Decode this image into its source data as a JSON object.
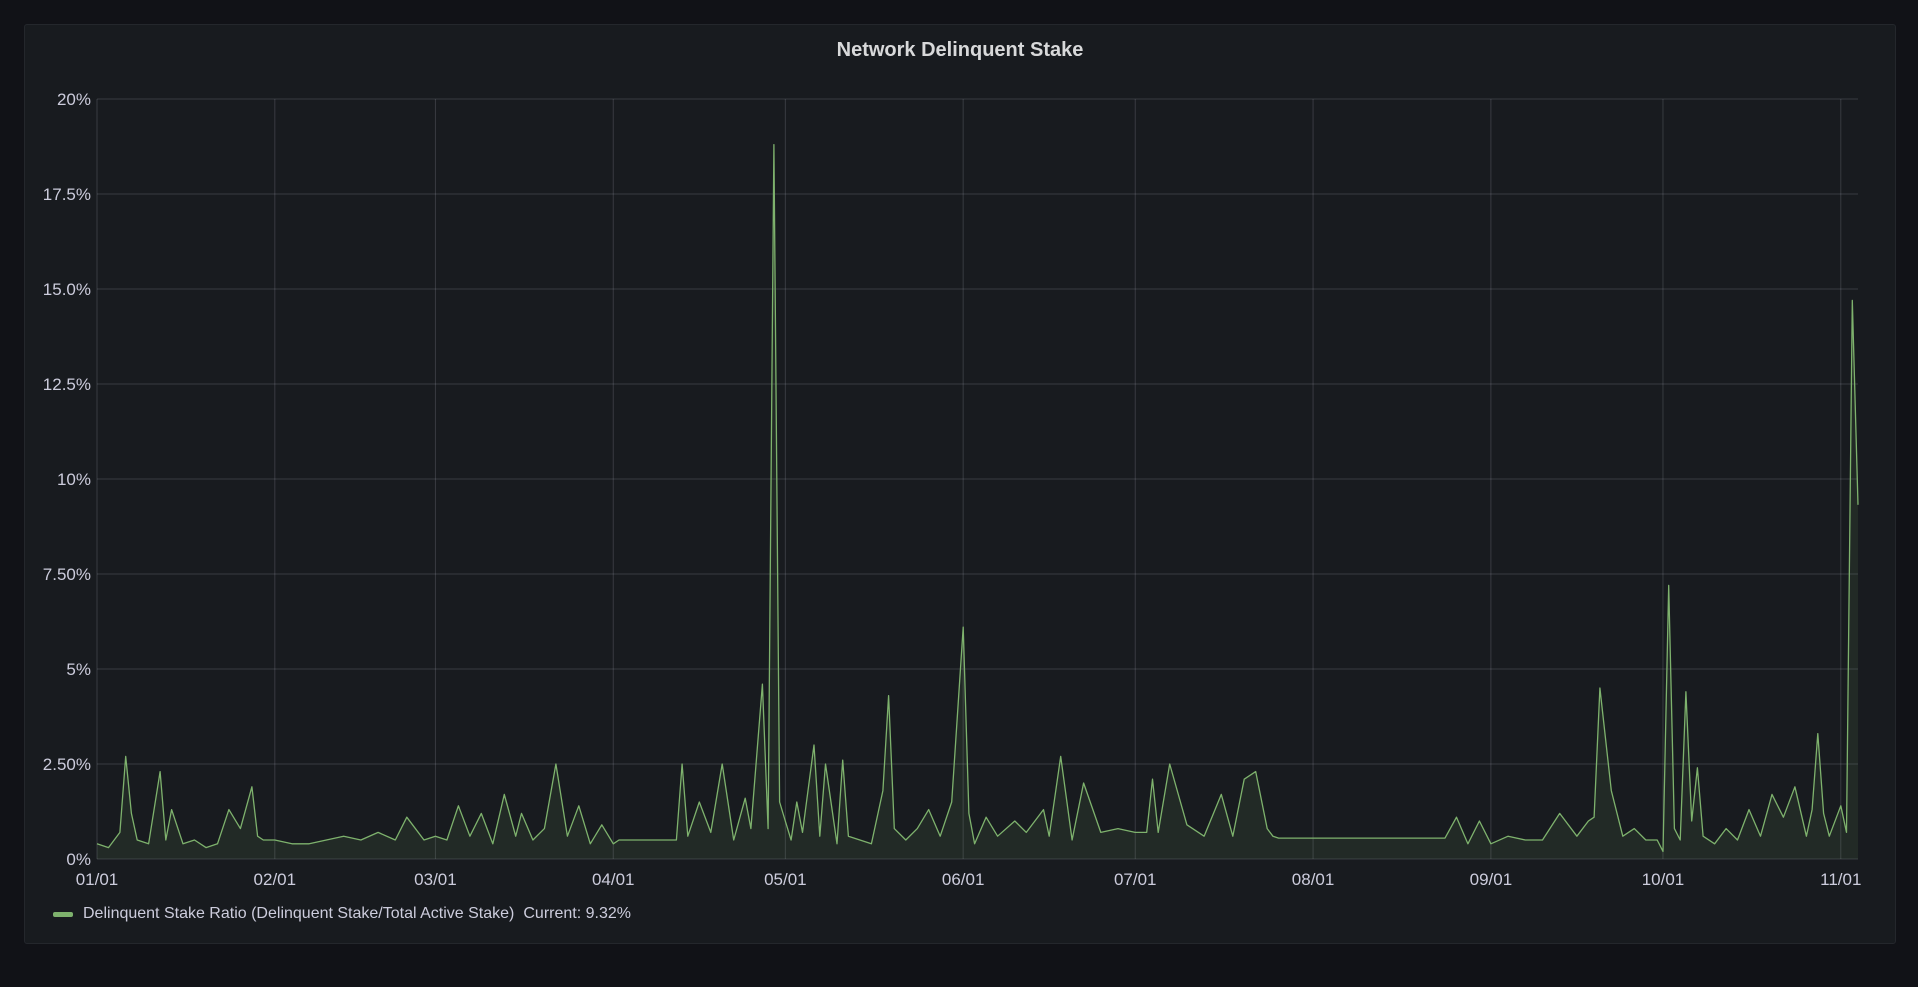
{
  "panel": {
    "title": "Network Delinquent Stake"
  },
  "chart_data": {
    "type": "area",
    "title": "Network Delinquent Stake",
    "line_color": "#7eb26d",
    "fill_color": "rgba(126,178,109,0.10)",
    "grid": true,
    "legend_position": "bottom-left",
    "y_unit": "%",
    "ylim": [
      0,
      20
    ],
    "yticks": [
      0,
      2.5,
      5,
      7.5,
      10,
      12.5,
      15,
      17.5,
      20
    ],
    "ytick_labels": [
      "0%",
      "2.50%",
      "5%",
      "7.50%",
      "10%",
      "12.5%",
      "15.0%",
      "17.5%",
      "20%"
    ],
    "xlim": [
      "2021-01-01",
      "2021-11-04"
    ],
    "xticks": [
      "2021-01-01",
      "2021-02-01",
      "2021-03-01",
      "2021-04-01",
      "2021-05-01",
      "2021-06-01",
      "2021-07-01",
      "2021-08-01",
      "2021-09-01",
      "2021-10-01",
      "2021-11-01"
    ],
    "xtick_labels": [
      "01/01",
      "02/01",
      "03/01",
      "04/01",
      "05/01",
      "06/01",
      "07/01",
      "08/01",
      "09/01",
      "10/01",
      "11/01"
    ],
    "series": [
      {
        "name": "Delinquent Stake Ratio (Delinquent Stake/Total Active Stake)",
        "current_label": "Current: 9.32%",
        "x": [
          "2021-01-01",
          "2021-01-03",
          "2021-01-05",
          "2021-01-06",
          "2021-01-07",
          "2021-01-08",
          "2021-01-10",
          "2021-01-12",
          "2021-01-13",
          "2021-01-14",
          "2021-01-16",
          "2021-01-18",
          "2021-01-20",
          "2021-01-22",
          "2021-01-24",
          "2021-01-26",
          "2021-01-28",
          "2021-01-29",
          "2021-01-30",
          "2021-02-01",
          "2021-02-04",
          "2021-02-07",
          "2021-02-10",
          "2021-02-13",
          "2021-02-16",
          "2021-02-19",
          "2021-02-22",
          "2021-02-24",
          "2021-02-27",
          "2021-03-01",
          "2021-03-03",
          "2021-03-05",
          "2021-03-07",
          "2021-03-09",
          "2021-03-11",
          "2021-03-13",
          "2021-03-15",
          "2021-03-16",
          "2021-03-18",
          "2021-03-20",
          "2021-03-22",
          "2021-03-24",
          "2021-03-26",
          "2021-03-28",
          "2021-03-30",
          "2021-04-01",
          "2021-04-02",
          "2021-04-12",
          "2021-04-13",
          "2021-04-14",
          "2021-04-16",
          "2021-04-18",
          "2021-04-20",
          "2021-04-22",
          "2021-04-24",
          "2021-04-25",
          "2021-04-27",
          "2021-04-28",
          "2021-04-29",
          "2021-04-30",
          "2021-05-01",
          "2021-05-02",
          "2021-05-03",
          "2021-05-04",
          "2021-05-06",
          "2021-05-07",
          "2021-05-08",
          "2021-05-10",
          "2021-05-11",
          "2021-05-12",
          "2021-05-14",
          "2021-05-16",
          "2021-05-18",
          "2021-05-19",
          "2021-05-20",
          "2021-05-22",
          "2021-05-24",
          "2021-05-26",
          "2021-05-28",
          "2021-05-30",
          "2021-06-01",
          "2021-06-02",
          "2021-06-03",
          "2021-06-05",
          "2021-06-07",
          "2021-06-10",
          "2021-06-12",
          "2021-06-15",
          "2021-06-16",
          "2021-06-18",
          "2021-06-20",
          "2021-06-22",
          "2021-06-25",
          "2021-06-28",
          "2021-07-01",
          "2021-07-03",
          "2021-07-04",
          "2021-07-05",
          "2021-07-07",
          "2021-07-10",
          "2021-07-13",
          "2021-07-16",
          "2021-07-18",
          "2021-07-20",
          "2021-07-22",
          "2021-07-24",
          "2021-07-25",
          "2021-07-26",
          "2021-08-24",
          "2021-08-26",
          "2021-08-28",
          "2021-08-30",
          "2021-09-01",
          "2021-09-04",
          "2021-09-07",
          "2021-09-10",
          "2021-09-13",
          "2021-09-16",
          "2021-09-18",
          "2021-09-19",
          "2021-09-20",
          "2021-09-22",
          "2021-09-24",
          "2021-09-26",
          "2021-09-28",
          "2021-09-30",
          "2021-10-01",
          "2021-10-02",
          "2021-10-03",
          "2021-10-04",
          "2021-10-05",
          "2021-10-06",
          "2021-10-07",
          "2021-10-08",
          "2021-10-10",
          "2021-10-12",
          "2021-10-14",
          "2021-10-16",
          "2021-10-18",
          "2021-10-20",
          "2021-10-22",
          "2021-10-24",
          "2021-10-26",
          "2021-10-27",
          "2021-10-28",
          "2021-10-29",
          "2021-10-30",
          "2021-11-01",
          "2021-11-02",
          "2021-11-03",
          "2021-11-04"
        ],
        "values": [
          0.4,
          0.3,
          0.7,
          2.7,
          1.2,
          0.5,
          0.4,
          2.3,
          0.5,
          1.3,
          0.4,
          0.5,
          0.3,
          0.4,
          1.3,
          0.8,
          1.9,
          0.6,
          0.5,
          0.5,
          0.4,
          0.4,
          0.5,
          0.6,
          0.5,
          0.7,
          0.5,
          1.1,
          0.5,
          0.6,
          0.5,
          1.4,
          0.6,
          1.2,
          0.4,
          1.7,
          0.6,
          1.2,
          0.5,
          0.8,
          2.5,
          0.6,
          1.4,
          0.4,
          0.9,
          0.4,
          0.5,
          0.5,
          2.5,
          0.6,
          1.5,
          0.7,
          2.5,
          0.5,
          1.6,
          0.8,
          4.6,
          0.8,
          18.8,
          1.5,
          1.0,
          0.5,
          1.5,
          0.7,
          3.0,
          0.6,
          2.5,
          0.4,
          2.6,
          0.6,
          0.5,
          0.4,
          1.8,
          4.3,
          0.8,
          0.5,
          0.8,
          1.3,
          0.6,
          1.5,
          6.1,
          1.2,
          0.4,
          1.1,
          0.6,
          1.0,
          0.7,
          1.3,
          0.6,
          2.7,
          0.5,
          2.0,
          0.7,
          0.8,
          0.7,
          0.7,
          2.1,
          0.7,
          2.5,
          0.9,
          0.6,
          1.7,
          0.6,
          2.1,
          2.3,
          0.8,
          0.6,
          0.55,
          0.55,
          1.1,
          0.4,
          1.0,
          0.4,
          0.6,
          0.5,
          0.5,
          1.2,
          0.6,
          1.0,
          1.1,
          4.5,
          1.8,
          0.6,
          0.8,
          0.5,
          0.5,
          0.2,
          7.2,
          0.8,
          0.5,
          4.4,
          1.0,
          2.4,
          0.6,
          0.4,
          0.8,
          0.5,
          1.3,
          0.6,
          1.7,
          1.1,
          1.9,
          0.6,
          1.3,
          3.3,
          1.2,
          0.6,
          1.4,
          0.7,
          14.7,
          9.32
        ]
      }
    ]
  }
}
